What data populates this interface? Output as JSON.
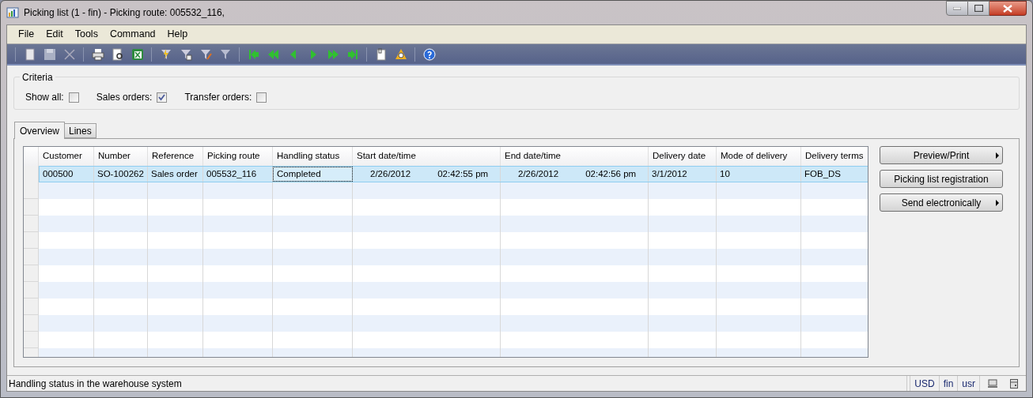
{
  "window": {
    "title": "Picking list (1 - fin) - Picking route: 005532_116,"
  },
  "menu": [
    "File",
    "Edit",
    "Tools",
    "Command",
    "Help"
  ],
  "criteria": {
    "title": "Criteria",
    "options": [
      {
        "label": "Show all:",
        "checked": false
      },
      {
        "label": "Sales orders:",
        "checked": true
      },
      {
        "label": "Transfer orders:",
        "checked": false
      }
    ]
  },
  "tabs": [
    {
      "label": "Overview",
      "selected": true
    },
    {
      "label": "Lines",
      "selected": false
    }
  ],
  "table": {
    "columns": [
      "Customer",
      "Number",
      "Reference",
      "Picking route",
      "Handling status",
      "Start date/time",
      "End date/time",
      "Delivery date",
      "Mode of delivery",
      "Delivery terms"
    ],
    "rows": [
      {
        "selected": true,
        "cells": [
          {
            "text": "000500",
            "focused": false
          },
          {
            "text": "SO-100262",
            "focused": false
          },
          {
            "text": "Sales order",
            "focused": false
          },
          {
            "text": "005532_116",
            "focused": false
          },
          {
            "text": "Completed",
            "focused": true
          },
          {
            "date": "2/26/2012",
            "time": "02:42:55 pm",
            "focused": false
          },
          {
            "date": "2/26/2012",
            "time": "02:42:56 pm",
            "focused": false
          },
          {
            "text": "3/1/2012",
            "focused": false
          },
          {
            "text": "10",
            "focused": false
          },
          {
            "text": "FOB_DS",
            "focused": false
          }
        ]
      }
    ]
  },
  "buttons": [
    {
      "label": "Preview/Print",
      "menu": true
    },
    {
      "label": "Picking list registration",
      "menu": false
    },
    {
      "label": "Send electronically",
      "menu": true
    }
  ],
  "status_bar": {
    "message": "Handling status in the warehouse system",
    "fields": [
      "USD",
      "fin",
      "usr"
    ]
  }
}
